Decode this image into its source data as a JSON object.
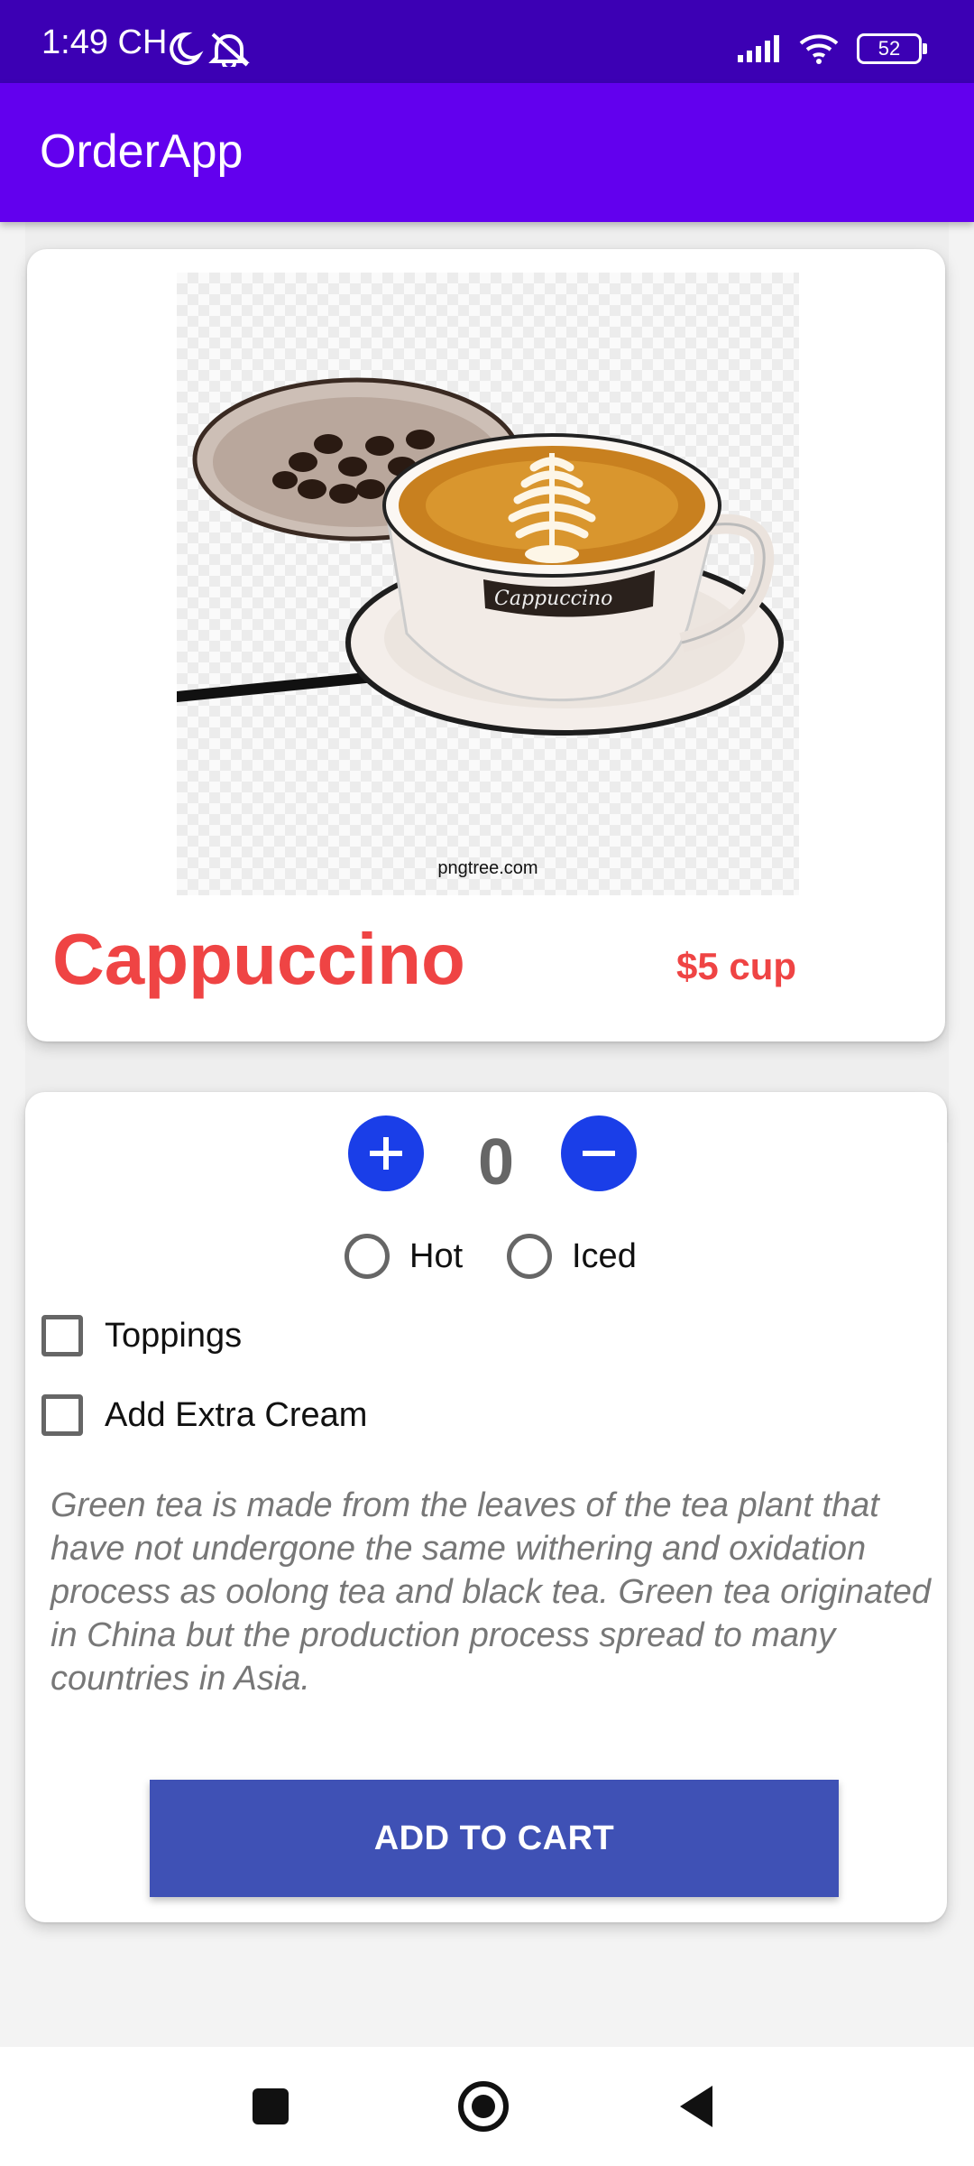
{
  "status_bar": {
    "time": "1:49 CH",
    "battery": "52",
    "icons": [
      "moon-icon",
      "notifications-off-icon",
      "signal-icon",
      "wifi-icon",
      "battery-icon"
    ]
  },
  "app_bar": {
    "title": "OrderApp"
  },
  "product": {
    "name": "Cappuccino",
    "price": "$5 cup",
    "image_watermark": "pngtree.com",
    "image_cup_text": "Cappuccino"
  },
  "options": {
    "quantity": "0",
    "plus_symbol": "+",
    "minus_symbol": "−",
    "temperature": {
      "hot_label": "Hot",
      "iced_label": "Iced",
      "selected": null
    },
    "toppings_label": "Toppings",
    "toppings_checked": false,
    "extra_cream_label": "Add Extra Cream",
    "extra_cream_checked": false,
    "description": "Green tea is made from the leaves of the tea plant that have not undergone the same withering and oxidation process as oolong tea and black tea. Green tea originated in China but the production process spread to many countries in Asia."
  },
  "cart": {
    "button_label": "ADD TO CART"
  },
  "nav_bar": {
    "icons": [
      "recents-square-icon",
      "home-circle-icon",
      "back-triangle-icon"
    ]
  },
  "colors": {
    "status_bar": "#3c00b4",
    "app_bar": "#6200ee",
    "accent_red": "#ef4444",
    "quantity_button": "#1a3ee8",
    "cart_button": "#3f51b5"
  }
}
